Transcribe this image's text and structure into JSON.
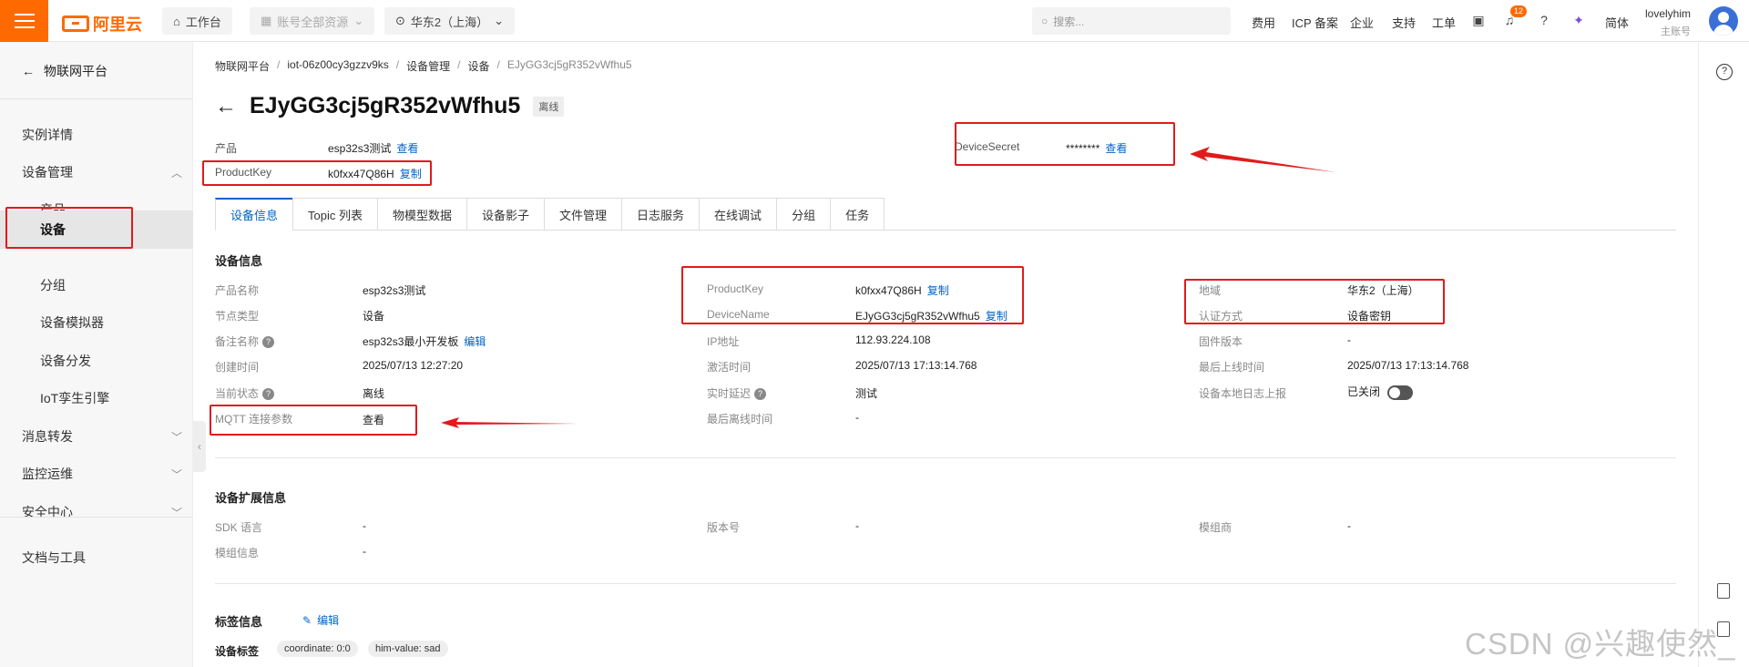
{
  "topbar": {
    "brand": "阿里云",
    "workbench": "工作台",
    "resource_group": "账号全部资源",
    "region": "华东2（上海）",
    "search_placeholder": "搜索...",
    "links": [
      "费用",
      "ICP 备案",
      "企业",
      "支持",
      "工单"
    ],
    "notification_count": "12",
    "language": "简体",
    "user_name": "lovelyhim",
    "user_role": "主账号"
  },
  "sidebar": {
    "back_label": "物联网平台",
    "items": [
      {
        "label": "实例详情"
      },
      {
        "label": "设备管理"
      },
      {
        "label": "产品"
      },
      {
        "label": "设备"
      },
      {
        "label": "分组"
      },
      {
        "label": "设备模拟器"
      },
      {
        "label": "设备分发"
      },
      {
        "label": "IoT孪生引擎"
      },
      {
        "label": "消息转发"
      },
      {
        "label": "监控运维"
      },
      {
        "label": "安全中心"
      },
      {
        "label": "文档与工具"
      }
    ]
  },
  "breadcrumb": [
    "物联网平台",
    "iot-06z00cy3gzzv9ks",
    "设备管理",
    "设备",
    "EJyGG3cj5gR352vWfhu5"
  ],
  "device": {
    "name": "EJyGG3cj5gR352vWfhu5",
    "status_tag": "离线",
    "product_label": "产品",
    "product_value": "esp32s3测试",
    "view_label": "查看",
    "productkey_label": "ProductKey",
    "productkey_value": "k0fxx47Q86H",
    "copy_label": "复制",
    "devicesecret_label": "DeviceSecret",
    "devicesecret_value": "********"
  },
  "tabs": [
    "设备信息",
    "Topic 列表",
    "物模型数据",
    "设备影子",
    "文件管理",
    "日志服务",
    "在线调试",
    "分组",
    "任务"
  ],
  "info": {
    "title": "设备信息",
    "col1": [
      {
        "label": "产品名称",
        "value": "esp32s3测试"
      },
      {
        "label": "节点类型",
        "value": "设备"
      },
      {
        "label": "备注名称",
        "value": "esp32s3最小开发板",
        "action": "编辑"
      },
      {
        "label": "创建时间",
        "value": "2025/07/13 12:27:20"
      },
      {
        "label": "当前状态",
        "value": "离线"
      },
      {
        "label": "MQTT 连接参数",
        "value": "查看"
      }
    ],
    "col2": [
      {
        "label": "ProductKey",
        "value": "k0fxx47Q86H",
        "action": "复制"
      },
      {
        "label": "DeviceName",
        "value": "EJyGG3cj5gR352vWfhu5",
        "action": "复制"
      },
      {
        "label": "IP地址",
        "value": "112.93.224.108"
      },
      {
        "label": "激活时间",
        "value": "2025/07/13 17:13:14.768"
      },
      {
        "label": "实时延迟",
        "value": "测试"
      },
      {
        "label": "最后离线时间",
        "value": "-"
      }
    ],
    "col3": [
      {
        "label": "地域",
        "value": "华东2（上海）"
      },
      {
        "label": "认证方式",
        "value": "设备密钥"
      },
      {
        "label": "固件版本",
        "value": "-"
      },
      {
        "label": "最后上线时间",
        "value": "2025/07/13 17:13:14.768"
      },
      {
        "label": "设备本地日志上报",
        "value": "已关闭"
      }
    ]
  },
  "ext": {
    "title": "设备扩展信息",
    "sdk_label": "SDK 语言",
    "sdk_value": "-",
    "version_label": "版本号",
    "version_value": "-",
    "vendor_label": "模组商",
    "vendor_value": "-",
    "module_label": "模组信息",
    "module_value": "-"
  },
  "tags": {
    "title": "标签信息",
    "edit_label": "编辑",
    "row_label": "设备标签",
    "chips": [
      "coordinate: 0:0",
      "him-value: sad"
    ]
  },
  "watermark": "CSDN @兴趣使然_"
}
